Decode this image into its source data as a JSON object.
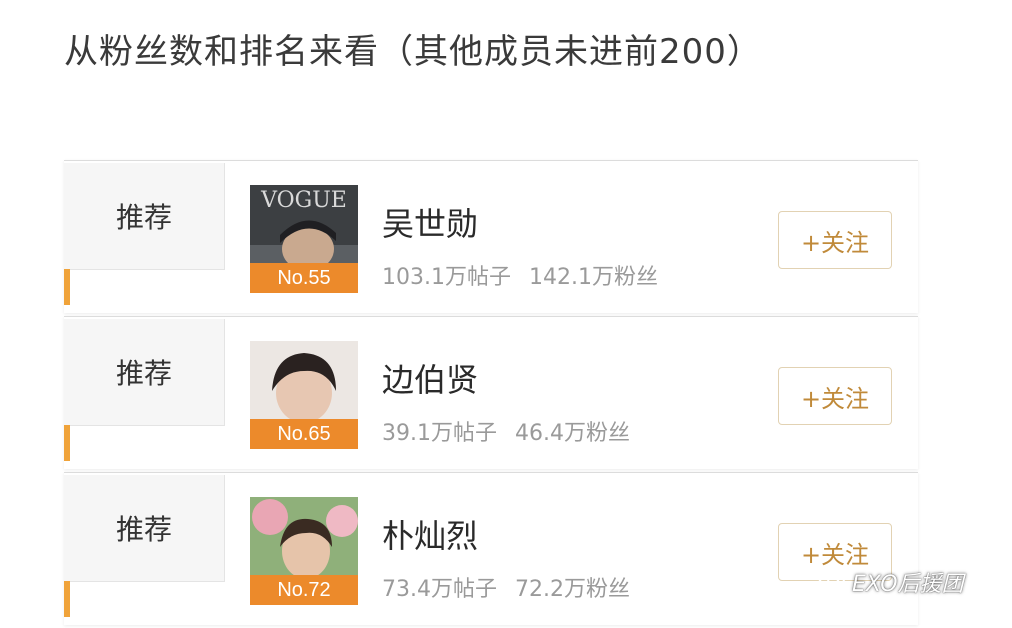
{
  "heading": "从粉丝数和排名来看（其他成员未进前200）",
  "members": [
    {
      "tab_label": "推荐",
      "rank": "No.55",
      "name": "吴世勋",
      "posts": "103.1万帖子",
      "fans": "142.1万粉丝",
      "follow_label": "+关注",
      "avatar_logo": "VOGUE"
    },
    {
      "tab_label": "推荐",
      "rank": "No.65",
      "name": "边伯贤",
      "posts": "39.1万帖子",
      "fans": "46.4万粉丝",
      "follow_label": "+关注"
    },
    {
      "tab_label": "推荐",
      "rank": "No.72",
      "name": "朴灿烈",
      "posts": "73.4万帖子",
      "fans": "72.2万粉丝",
      "follow_label": "+关注"
    }
  ],
  "watermark": "EXO后援团",
  "colors": {
    "accent": "#f0a33a",
    "rank_badge": "#ec8a2b",
    "follow_text": "#c08a3a"
  },
  "icons": {
    "watermark": "wechat-icon"
  }
}
